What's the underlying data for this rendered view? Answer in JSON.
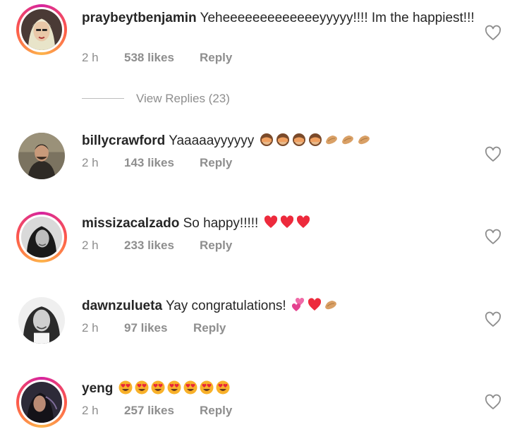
{
  "comments": [
    {
      "username": "praybeytbenjamin",
      "text": "Yeheeeeeeeeeeeeeyyyyy!!!! Im the happiest!!!",
      "time": "2 h",
      "likes": "538 likes",
      "reply": "Reply",
      "story_ring": true
    },
    {
      "username": "billycrawford",
      "text": "Yaaaaayyyyyy",
      "emojis": [
        "see-no-evil-monkey",
        "see-no-evil-monkey",
        "see-no-evil-monkey",
        "see-no-evil-monkey",
        "clapping-hands",
        "clapping-hands",
        "clapping-hands"
      ],
      "time": "2 h",
      "likes": "143 likes",
      "reply": "Reply",
      "story_ring": false
    },
    {
      "username": "missizacalzado",
      "text": "So happy!!!!!",
      "emojis": [
        "red-heart",
        "red-heart",
        "red-heart"
      ],
      "time": "2 h",
      "likes": "233 likes",
      "reply": "Reply",
      "story_ring": true
    },
    {
      "username": "dawnzulueta",
      "text": "Yay congratulations!",
      "emojis": [
        "two-hearts",
        "red-heart",
        "clapping-hands"
      ],
      "time": "2 h",
      "likes": "97 likes",
      "reply": "Reply",
      "story_ring": false
    },
    {
      "username": "yeng",
      "text": "",
      "emojis": [
        "heart-eyes-face",
        "heart-eyes-face",
        "heart-eyes-face",
        "heart-eyes-face",
        "heart-eyes-face",
        "heart-eyes-face",
        "heart-eyes-face"
      ],
      "time": "2 h",
      "likes": "257 likes",
      "reply": "Reply",
      "story_ring": true
    }
  ],
  "view_replies": "View Replies (23)",
  "colors": {
    "text": "#262626",
    "meta": "#8e8e8e",
    "heart_red": "#ed2a3c",
    "hand_tan": "#d9a066",
    "monkey_brown": "#a0522d",
    "face_yellow": "#f8b12a"
  },
  "icons": {
    "like": "heart-outline-icon"
  }
}
